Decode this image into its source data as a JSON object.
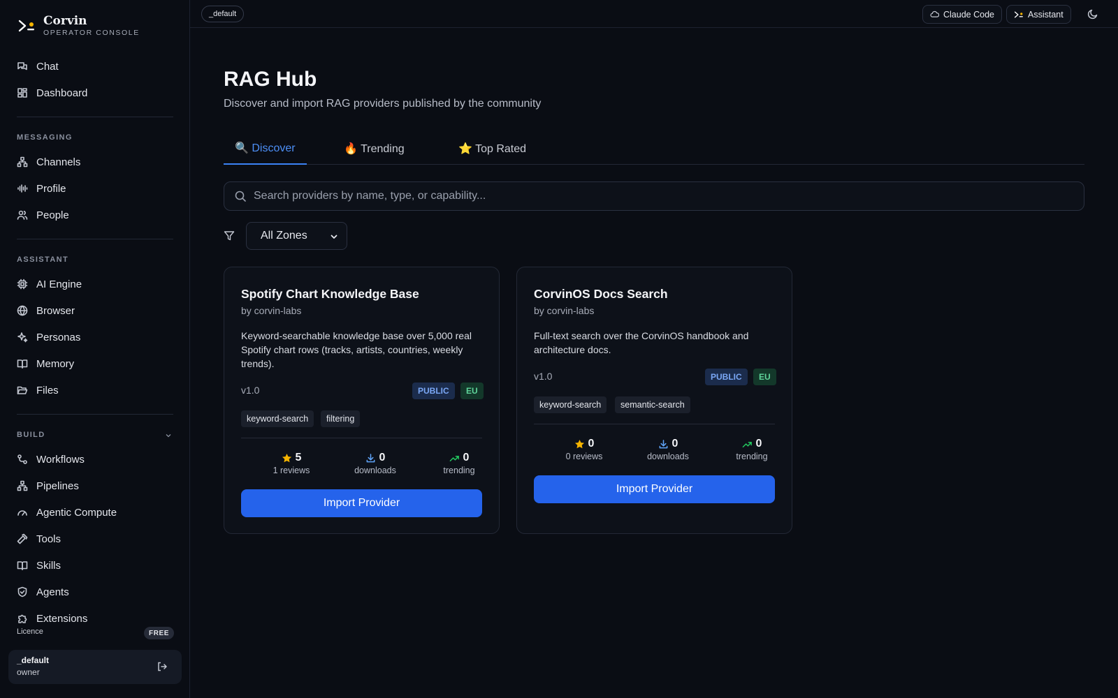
{
  "brand": {
    "name": "Corvin",
    "subtitle": "OPERATOR CONSOLE"
  },
  "nav": {
    "chat": "Chat",
    "dashboard": "Dashboard",
    "messaging_label": "MESSAGING",
    "channels": "Channels",
    "profile": "Profile",
    "people": "People",
    "assistant_label": "ASSISTANT",
    "ai_engine": "AI Engine",
    "browser": "Browser",
    "personas": "Personas",
    "memory": "Memory",
    "files": "Files",
    "build_label": "BUILD",
    "workflows": "Workflows",
    "pipelines": "Pipelines",
    "agentic_compute": "Agentic Compute",
    "tools": "Tools",
    "skills": "Skills",
    "agents": "Agents",
    "extensions": "Extensions"
  },
  "licence": {
    "label": "Licence",
    "tier": "FREE"
  },
  "user": {
    "name": "_default",
    "role": "owner"
  },
  "topbar": {
    "workspace": "_default",
    "claude_code": "Claude Code",
    "assistant": "Assistant"
  },
  "page": {
    "title": "RAG Hub",
    "subtitle": "Discover and import RAG providers published by the community"
  },
  "tabs": [
    {
      "label": "🔍 Discover",
      "active": true
    },
    {
      "label": "🔥 Trending",
      "active": false
    },
    {
      "label": "⭐ Top Rated",
      "active": false
    }
  ],
  "search": {
    "placeholder": "Search providers by name, type, or capability..."
  },
  "filter": {
    "zone": "All Zones"
  },
  "providers": [
    {
      "title": "Spotify Chart Knowledge Base",
      "author": "by corvin-labs",
      "description": "Keyword-searchable knowledge base over 5,000 real Spotify chart rows (tracks, artists, countries, weekly trends).",
      "version": "v1.0",
      "visibility": "PUBLIC",
      "zone": "EU",
      "tags": [
        "keyword-search",
        "filtering"
      ],
      "rating": "5",
      "reviews": "1 reviews",
      "downloads": "0",
      "downloads_label": "downloads",
      "trending": "0",
      "trending_label": "trending",
      "import_label": "Import Provider"
    },
    {
      "title": "CorvinOS Docs Search",
      "author": "by corvin-labs",
      "description": "Full-text search over the CorvinOS handbook and architecture docs.",
      "version": "v1.0",
      "visibility": "PUBLIC",
      "zone": "EU",
      "tags": [
        "keyword-search",
        "semantic-search"
      ],
      "rating": "0",
      "reviews": "0 reviews",
      "downloads": "0",
      "downloads_label": "downloads",
      "trending": "0",
      "trending_label": "trending",
      "import_label": "Import Provider"
    }
  ],
  "colors": {
    "background": "#0a0d14",
    "accent": "#2563eb",
    "tab_active": "#4d8ff7",
    "star": "#f5b400",
    "trend": "#22c55e",
    "download": "#60a5fa"
  }
}
